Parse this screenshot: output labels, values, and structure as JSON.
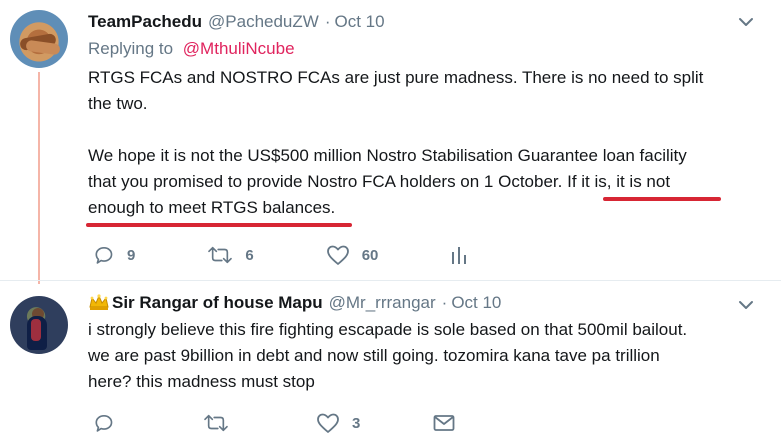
{
  "tweets": [
    {
      "display_name": "TeamPachedu",
      "handle": "@PacheduZW",
      "date": "Oct 10",
      "reply_to_label": "Replying to",
      "reply_to_mention": "@MthuliNcube",
      "text_line_1": "RTGS FCAs and NOSTRO FCAs are just pure madness. There is no need to  split",
      "text_line_2": "the two.",
      "text_line_3": "We hope it is not the US$500 million Nostro Stabilisation Guarantee loan  facility",
      "text_line_4_plain": "that you promised to provide Nostro FCA holders on 1 October. ",
      "text_line_4_highlight": "If it is, it is not",
      "text_line_5": "enough to meet RTGS balances.",
      "actions": {
        "reply_count": "9",
        "retweet_count": "6",
        "like_count": "60"
      }
    },
    {
      "display_name": "Sir Rangar of house Mapu",
      "handle": "@Mr_rrrangar",
      "date": "Oct 10",
      "text_line_1": "i strongly believe this fire fighting escapade is sole based on that 500mil bailout.",
      "text_line_2": "we are past 9billion in debt and now still going. tozomira kana tave pa trillion",
      "text_line_3": "here? this madness must stop",
      "actions": {
        "reply_count": "",
        "retweet_count": "",
        "like_count": "3"
      }
    }
  ],
  "icons": {
    "reply": "reply-icon",
    "retweet": "retweet-icon",
    "like": "heart-icon",
    "analytics": "analytics-icon",
    "dm": "envelope-icon",
    "caret": "chevron-down-icon",
    "crown": "crown-icon"
  },
  "colors": {
    "mention": "#e0245e",
    "thread_line": "#f5b5a8",
    "underline": "#d72634",
    "muted": "#657786"
  }
}
